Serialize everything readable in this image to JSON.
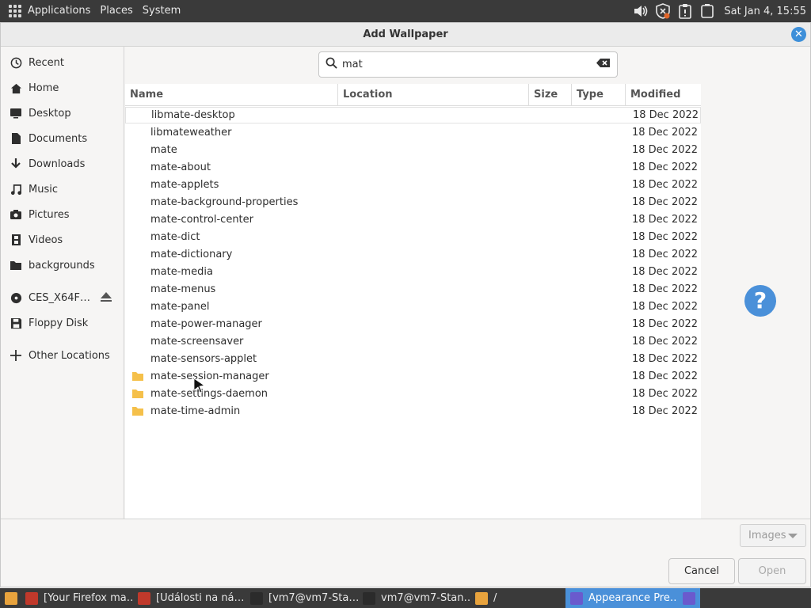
{
  "top_panel": {
    "menus": [
      "Applications",
      "Places",
      "System"
    ],
    "clock": "Sat Jan  4, 15:55",
    "tray_icons": [
      "volume-icon",
      "shield-icon",
      "clipboard-icon",
      "battery-icon"
    ]
  },
  "dialog": {
    "title": "Add Wallpaper",
    "search": {
      "value": "mat"
    },
    "columns": [
      "Name",
      "Location",
      "Size",
      "Type",
      "Modified"
    ],
    "places": [
      {
        "label": "Recent",
        "icon": "clock-icon"
      },
      {
        "label": "Home",
        "icon": "home-icon"
      },
      {
        "label": "Desktop",
        "icon": "desktop-icon"
      },
      {
        "label": "Documents",
        "icon": "document-icon"
      },
      {
        "label": "Downloads",
        "icon": "download-icon"
      },
      {
        "label": "Music",
        "icon": "music-icon"
      },
      {
        "label": "Pictures",
        "icon": "camera-icon"
      },
      {
        "label": "Videos",
        "icon": "film-icon"
      },
      {
        "label": "backgrounds",
        "icon": "folder-icon"
      }
    ],
    "devices": [
      {
        "label": "CES_X64F…",
        "icon": "disc-icon"
      },
      {
        "label": "Floppy Disk",
        "icon": "floppy-icon"
      }
    ],
    "other_locations": "Other Locations",
    "files": [
      {
        "name": "libmate-desktop",
        "modified": "18 Dec 2022",
        "folder_icon": false
      },
      {
        "name": "libmateweather",
        "modified": "18 Dec 2022",
        "folder_icon": false
      },
      {
        "name": "mate",
        "modified": "18 Dec 2022",
        "folder_icon": false
      },
      {
        "name": "mate-about",
        "modified": "18 Dec 2022",
        "folder_icon": false
      },
      {
        "name": "mate-applets",
        "modified": "18 Dec 2022",
        "folder_icon": false
      },
      {
        "name": "mate-background-properties",
        "modified": "18 Dec 2022",
        "folder_icon": false
      },
      {
        "name": "mate-control-center",
        "modified": "18 Dec 2022",
        "folder_icon": false
      },
      {
        "name": "mate-dict",
        "modified": "18 Dec 2022",
        "folder_icon": false
      },
      {
        "name": "mate-dictionary",
        "modified": "18 Dec 2022",
        "folder_icon": false
      },
      {
        "name": "mate-media",
        "modified": "18 Dec 2022",
        "folder_icon": false
      },
      {
        "name": "mate-menus",
        "modified": "18 Dec 2022",
        "folder_icon": false
      },
      {
        "name": "mate-panel",
        "modified": "18 Dec 2022",
        "folder_icon": false
      },
      {
        "name": "mate-power-manager",
        "modified": "18 Dec 2022",
        "folder_icon": false
      },
      {
        "name": "mate-screensaver",
        "modified": "18 Dec 2022",
        "folder_icon": false
      },
      {
        "name": "mate-sensors-applet",
        "modified": "18 Dec 2022",
        "folder_icon": false
      },
      {
        "name": "mate-session-manager",
        "modified": "18 Dec 2022",
        "folder_icon": true
      },
      {
        "name": "mate-settings-daemon",
        "modified": "18 Dec 2022",
        "folder_icon": true
      },
      {
        "name": "mate-time-admin",
        "modified": "18 Dec 2022",
        "folder_icon": true
      }
    ],
    "filter": "Images",
    "cancel_label": "Cancel",
    "open_label": "Open"
  },
  "taskbar": {
    "tasks": [
      {
        "label": "",
        "icon_color": "#e8a33d",
        "active": false
      },
      {
        "label": "[Your Firefox ma…",
        "icon_color": "#c0392b",
        "active": false
      },
      {
        "label": "[Události na ná…",
        "icon_color": "#c0392b",
        "active": false
      },
      {
        "label": "[vm7@vm7-Sta…",
        "icon_color": "#2b2b2b",
        "active": false
      },
      {
        "label": "vm7@vm7-Stan…",
        "icon_color": "#2b2b2b",
        "active": false
      },
      {
        "label": "/",
        "icon_color": "#e8a33d",
        "active": false
      },
      {
        "label": "Appearance Pre…",
        "icon_color": "#6a5acd",
        "active": true
      },
      {
        "label": "",
        "icon_color": "#6a5acd",
        "active": true
      }
    ]
  },
  "colors": {
    "accent": "#4a90d9",
    "panel": "#3a3a3a",
    "folder": "#f5c04a"
  }
}
